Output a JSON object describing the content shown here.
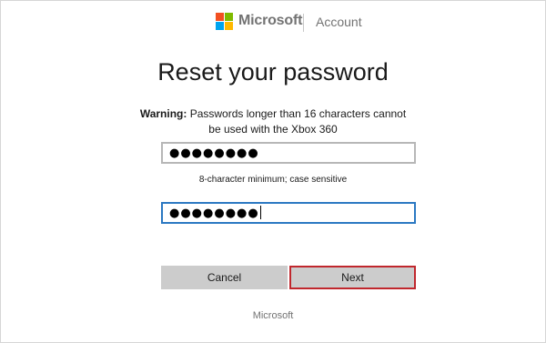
{
  "header": {
    "brand": "Microsoft",
    "section": "Account"
  },
  "main": {
    "title": "Reset your password",
    "warning_label": "Warning:",
    "warning_text": "Passwords longer than 16 characters cannot be used with the Xbox 360",
    "password_masked": "●●●●●●●●",
    "confirm_masked": "●●●●●●●●",
    "hint": "8-character minimum; case sensitive"
  },
  "buttons": {
    "cancel": "Cancel",
    "next": "Next"
  },
  "footer": {
    "brand": "Microsoft"
  },
  "colors": {
    "logo_red": "#f25022",
    "logo_green": "#7fba00",
    "logo_blue": "#00a4ef",
    "logo_yellow": "#ffb900",
    "focus_border": "#2b78c2",
    "next_border": "#c0272d"
  }
}
